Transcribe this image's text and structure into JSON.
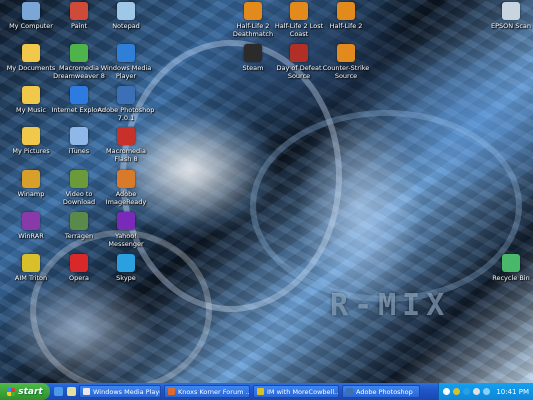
{
  "desktop": {
    "logo_text": "R-MIX",
    "icons": [
      {
        "label": "My Computer",
        "icon": "computer-icon",
        "color": "#7aa7d8"
      },
      {
        "label": "Paint",
        "icon": "paint-icon",
        "color": "#d04a3a"
      },
      {
        "label": "Notepad",
        "icon": "notepad-icon",
        "color": "#9fc8e8"
      },
      {
        "label": "Half-Life 2 Deathmatch",
        "icon": "half-life-icon",
        "color": "#e38a1c"
      },
      {
        "label": "Half-Life 2 Lost Coast",
        "icon": "half-life-icon",
        "color": "#e38a1c"
      },
      {
        "label": "Half-Life 2",
        "icon": "half-life-icon",
        "color": "#e38a1c"
      },
      {
        "label": "EPSON Scan",
        "icon": "scanner-icon",
        "color": "#c8d4e0"
      },
      {
        "label": "My Documents",
        "icon": "documents-folder-icon",
        "color": "#f0c94a"
      },
      {
        "label": "Macromedia Dreamweaver 8",
        "icon": "dreamweaver-icon",
        "color": "#4db34a"
      },
      {
        "label": "Windows Media Player",
        "icon": "media-player-icon",
        "color": "#2f7fd6"
      },
      {
        "label": "Steam",
        "icon": "steam-icon",
        "color": "#2b2b2b"
      },
      {
        "label": "Day of Defeat Source",
        "icon": "day-of-defeat-icon",
        "color": "#b03028"
      },
      {
        "label": "Counter-Strike Source",
        "icon": "counter-strike-icon",
        "color": "#e38a1c"
      },
      {
        "label": "My Music",
        "icon": "music-folder-icon",
        "color": "#f0c94a"
      },
      {
        "label": "Internet Explorer",
        "icon": "internet-explorer-icon",
        "color": "#2d7be0"
      },
      {
        "label": "Adobe Photoshop 7.0.1",
        "icon": "photoshop-icon",
        "color": "#3b6fb6"
      },
      {
        "label": "My Pictures",
        "icon": "pictures-folder-icon",
        "color": "#f0c94a"
      },
      {
        "label": "iTunes",
        "icon": "itunes-icon",
        "color": "#8fb8e8"
      },
      {
        "label": "Macromedia Flash 8",
        "icon": "flash-icon",
        "color": "#c8302a"
      },
      {
        "label": "Winamp",
        "icon": "winamp-icon",
        "color": "#d8a02a"
      },
      {
        "label": "Video to Download",
        "icon": "video-download-icon",
        "color": "#6a9a3a"
      },
      {
        "label": "Adobe ImageReady",
        "icon": "imageready-icon",
        "color": "#d87a2a"
      },
      {
        "label": "WinRAR",
        "icon": "winrar-icon",
        "color": "#8a3aa8"
      },
      {
        "label": "Terragen",
        "icon": "terragen-icon",
        "color": "#5a8a4a"
      },
      {
        "label": "Yahoo! Messenger",
        "icon": "yahoo-messenger-icon",
        "color": "#7a2ab8"
      },
      {
        "label": "AIM Triton",
        "icon": "aim-icon",
        "color": "#d8c02a"
      },
      {
        "label": "Opera",
        "icon": "opera-icon",
        "color": "#d8282a"
      },
      {
        "label": "Skype",
        "icon": "skype-icon",
        "color": "#2aa0e0"
      },
      {
        "label": "Recycle Bin",
        "icon": "recycle-bin-icon",
        "color": "#4ab86a"
      }
    ]
  },
  "taskbar": {
    "start_label": "start",
    "quick_launch": [
      {
        "icon": "ie-quicklaunch-icon",
        "color": "#4a9ae8"
      },
      {
        "icon": "desktop-quicklaunch-icon",
        "color": "#e0e0a0"
      }
    ],
    "tasks": [
      {
        "label": "Windows Media Player",
        "icon": "media-player-icon",
        "color": "#e8e8e8"
      },
      {
        "label": "Knoxs Korner Forum ...",
        "icon": "browser-icon",
        "color": "#e06a2a"
      },
      {
        "label": "IM with MoreCowbell...",
        "icon": "aim-icon",
        "color": "#d8c02a"
      },
      {
        "label": "Adobe Photoshop",
        "icon": "photoshop-icon",
        "color": "#3b6fb6"
      }
    ],
    "tray_icons": [
      {
        "icon": "tray-chevron-icon",
        "color": "#ffffff"
      },
      {
        "icon": "tray-aim-icon",
        "color": "#d8c02a"
      },
      {
        "icon": "tray-skype-icon",
        "color": "#2aa0e0"
      },
      {
        "icon": "tray-volume-icon",
        "color": "#e0e0e0"
      },
      {
        "icon": "tray-network-icon",
        "color": "#8ad0ff"
      }
    ],
    "clock": "10:41 PM"
  }
}
